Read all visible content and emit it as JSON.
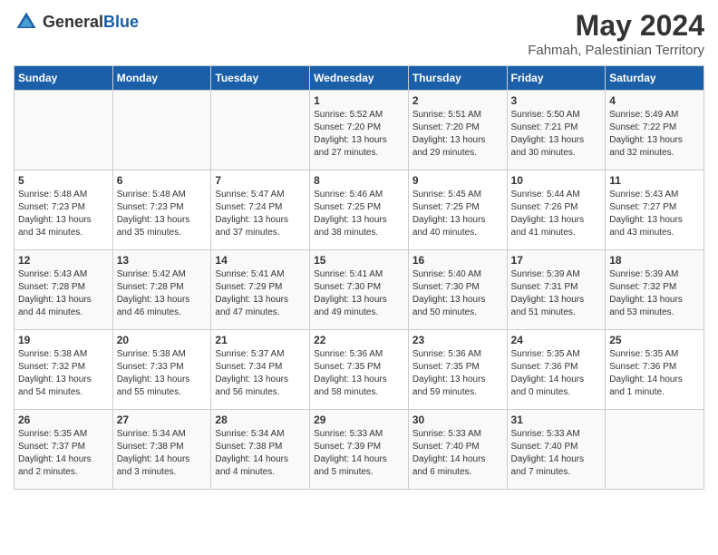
{
  "header": {
    "logo_general": "General",
    "logo_blue": "Blue",
    "month_year": "May 2024",
    "location": "Fahmah, Palestinian Territory"
  },
  "days_of_week": [
    "Sunday",
    "Monday",
    "Tuesday",
    "Wednesday",
    "Thursday",
    "Friday",
    "Saturday"
  ],
  "weeks": [
    [
      {
        "day": "",
        "text": ""
      },
      {
        "day": "",
        "text": ""
      },
      {
        "day": "",
        "text": ""
      },
      {
        "day": "1",
        "text": "Sunrise: 5:52 AM\nSunset: 7:20 PM\nDaylight: 13 hours\nand 27 minutes."
      },
      {
        "day": "2",
        "text": "Sunrise: 5:51 AM\nSunset: 7:20 PM\nDaylight: 13 hours\nand 29 minutes."
      },
      {
        "day": "3",
        "text": "Sunrise: 5:50 AM\nSunset: 7:21 PM\nDaylight: 13 hours\nand 30 minutes."
      },
      {
        "day": "4",
        "text": "Sunrise: 5:49 AM\nSunset: 7:22 PM\nDaylight: 13 hours\nand 32 minutes."
      }
    ],
    [
      {
        "day": "5",
        "text": "Sunrise: 5:48 AM\nSunset: 7:23 PM\nDaylight: 13 hours\nand 34 minutes."
      },
      {
        "day": "6",
        "text": "Sunrise: 5:48 AM\nSunset: 7:23 PM\nDaylight: 13 hours\nand 35 minutes."
      },
      {
        "day": "7",
        "text": "Sunrise: 5:47 AM\nSunset: 7:24 PM\nDaylight: 13 hours\nand 37 minutes."
      },
      {
        "day": "8",
        "text": "Sunrise: 5:46 AM\nSunset: 7:25 PM\nDaylight: 13 hours\nand 38 minutes."
      },
      {
        "day": "9",
        "text": "Sunrise: 5:45 AM\nSunset: 7:25 PM\nDaylight: 13 hours\nand 40 minutes."
      },
      {
        "day": "10",
        "text": "Sunrise: 5:44 AM\nSunset: 7:26 PM\nDaylight: 13 hours\nand 41 minutes."
      },
      {
        "day": "11",
        "text": "Sunrise: 5:43 AM\nSunset: 7:27 PM\nDaylight: 13 hours\nand 43 minutes."
      }
    ],
    [
      {
        "day": "12",
        "text": "Sunrise: 5:43 AM\nSunset: 7:28 PM\nDaylight: 13 hours\nand 44 minutes."
      },
      {
        "day": "13",
        "text": "Sunrise: 5:42 AM\nSunset: 7:28 PM\nDaylight: 13 hours\nand 46 minutes."
      },
      {
        "day": "14",
        "text": "Sunrise: 5:41 AM\nSunset: 7:29 PM\nDaylight: 13 hours\nand 47 minutes."
      },
      {
        "day": "15",
        "text": "Sunrise: 5:41 AM\nSunset: 7:30 PM\nDaylight: 13 hours\nand 49 minutes."
      },
      {
        "day": "16",
        "text": "Sunrise: 5:40 AM\nSunset: 7:30 PM\nDaylight: 13 hours\nand 50 minutes."
      },
      {
        "day": "17",
        "text": "Sunrise: 5:39 AM\nSunset: 7:31 PM\nDaylight: 13 hours\nand 51 minutes."
      },
      {
        "day": "18",
        "text": "Sunrise: 5:39 AM\nSunset: 7:32 PM\nDaylight: 13 hours\nand 53 minutes."
      }
    ],
    [
      {
        "day": "19",
        "text": "Sunrise: 5:38 AM\nSunset: 7:32 PM\nDaylight: 13 hours\nand 54 minutes."
      },
      {
        "day": "20",
        "text": "Sunrise: 5:38 AM\nSunset: 7:33 PM\nDaylight: 13 hours\nand 55 minutes."
      },
      {
        "day": "21",
        "text": "Sunrise: 5:37 AM\nSunset: 7:34 PM\nDaylight: 13 hours\nand 56 minutes."
      },
      {
        "day": "22",
        "text": "Sunrise: 5:36 AM\nSunset: 7:35 PM\nDaylight: 13 hours\nand 58 minutes."
      },
      {
        "day": "23",
        "text": "Sunrise: 5:36 AM\nSunset: 7:35 PM\nDaylight: 13 hours\nand 59 minutes."
      },
      {
        "day": "24",
        "text": "Sunrise: 5:35 AM\nSunset: 7:36 PM\nDaylight: 14 hours\nand 0 minutes."
      },
      {
        "day": "25",
        "text": "Sunrise: 5:35 AM\nSunset: 7:36 PM\nDaylight: 14 hours\nand 1 minute."
      }
    ],
    [
      {
        "day": "26",
        "text": "Sunrise: 5:35 AM\nSunset: 7:37 PM\nDaylight: 14 hours\nand 2 minutes."
      },
      {
        "day": "27",
        "text": "Sunrise: 5:34 AM\nSunset: 7:38 PM\nDaylight: 14 hours\nand 3 minutes."
      },
      {
        "day": "28",
        "text": "Sunrise: 5:34 AM\nSunset: 7:38 PM\nDaylight: 14 hours\nand 4 minutes."
      },
      {
        "day": "29",
        "text": "Sunrise: 5:33 AM\nSunset: 7:39 PM\nDaylight: 14 hours\nand 5 minutes."
      },
      {
        "day": "30",
        "text": "Sunrise: 5:33 AM\nSunset: 7:40 PM\nDaylight: 14 hours\nand 6 minutes."
      },
      {
        "day": "31",
        "text": "Sunrise: 5:33 AM\nSunset: 7:40 PM\nDaylight: 14 hours\nand 7 minutes."
      },
      {
        "day": "",
        "text": ""
      }
    ]
  ]
}
